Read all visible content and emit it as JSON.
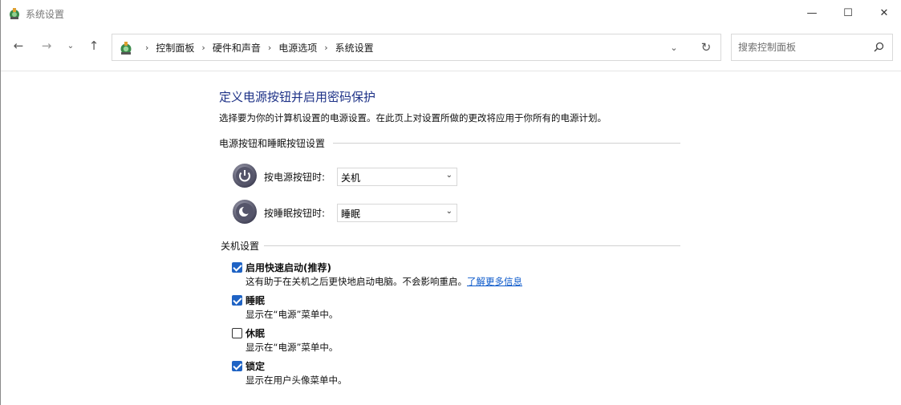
{
  "window": {
    "title": "系统设置",
    "minimize_glyph": "—",
    "maximize_glyph": "☐",
    "close_glyph": "✕"
  },
  "nav": {
    "back_glyph": "←",
    "forward_glyph": "→",
    "recent_glyph": "⌄",
    "up_glyph": "↑",
    "breadcrumbs": [
      "控制面板",
      "硬件和声音",
      "电源选项",
      "系统设置"
    ],
    "breadcrumb_sep": "›",
    "dropdown_glyph": "⌄",
    "refresh_glyph": "↻",
    "search_placeholder": "搜索控制面板"
  },
  "page": {
    "heading": "定义电源按钮并启用密码保护",
    "intro": "选择要为你的计算机设置的电源设置。在此页上对设置所做的更改将应用于你所有的电源计划。",
    "buttons_section": {
      "title": "电源按钮和睡眠按钮设置",
      "options": [
        {
          "label": "按电源按钮时:",
          "value": "关机",
          "icon": "power-icon"
        },
        {
          "label": "按睡眠按钮时:",
          "value": "睡眠",
          "icon": "sleep-icon"
        }
      ]
    },
    "shutdown_section": {
      "title": "关机设置",
      "items": [
        {
          "label": "启用快速启动(推荐)",
          "checked": true,
          "desc": "这有助于在关机之后更快地启动电脑。不会影响重启。",
          "link": "了解更多信息"
        },
        {
          "label": "睡眠",
          "checked": true,
          "desc": "显示在“电源”菜单中。"
        },
        {
          "label": "休眠",
          "checked": false,
          "desc": "显示在“电源”菜单中。"
        },
        {
          "label": "锁定",
          "checked": true,
          "desc": "显示在用户头像菜单中。"
        }
      ]
    }
  },
  "colors": {
    "heading": "#1e3287",
    "checkbox_accent": "#1f63c4",
    "link": "#0a58ca"
  }
}
